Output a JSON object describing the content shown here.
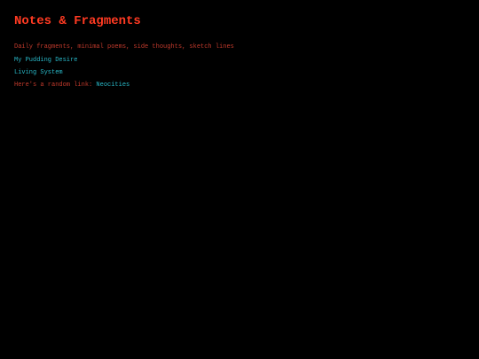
{
  "header": {
    "title": "Notes & Fragments",
    "subtitle": "Daily fragments, minimal poems, side thoughts, sketch lines"
  },
  "links": [
    {
      "label": "My Pudding Desire"
    },
    {
      "label": "Living System"
    }
  ],
  "random": {
    "prefix": "Here's a random link:",
    "link_label": "Neocities"
  },
  "colors": {
    "background": "#000000",
    "title": "#ff3a22",
    "text": "#c23a2c",
    "link": "#29b8c8"
  }
}
